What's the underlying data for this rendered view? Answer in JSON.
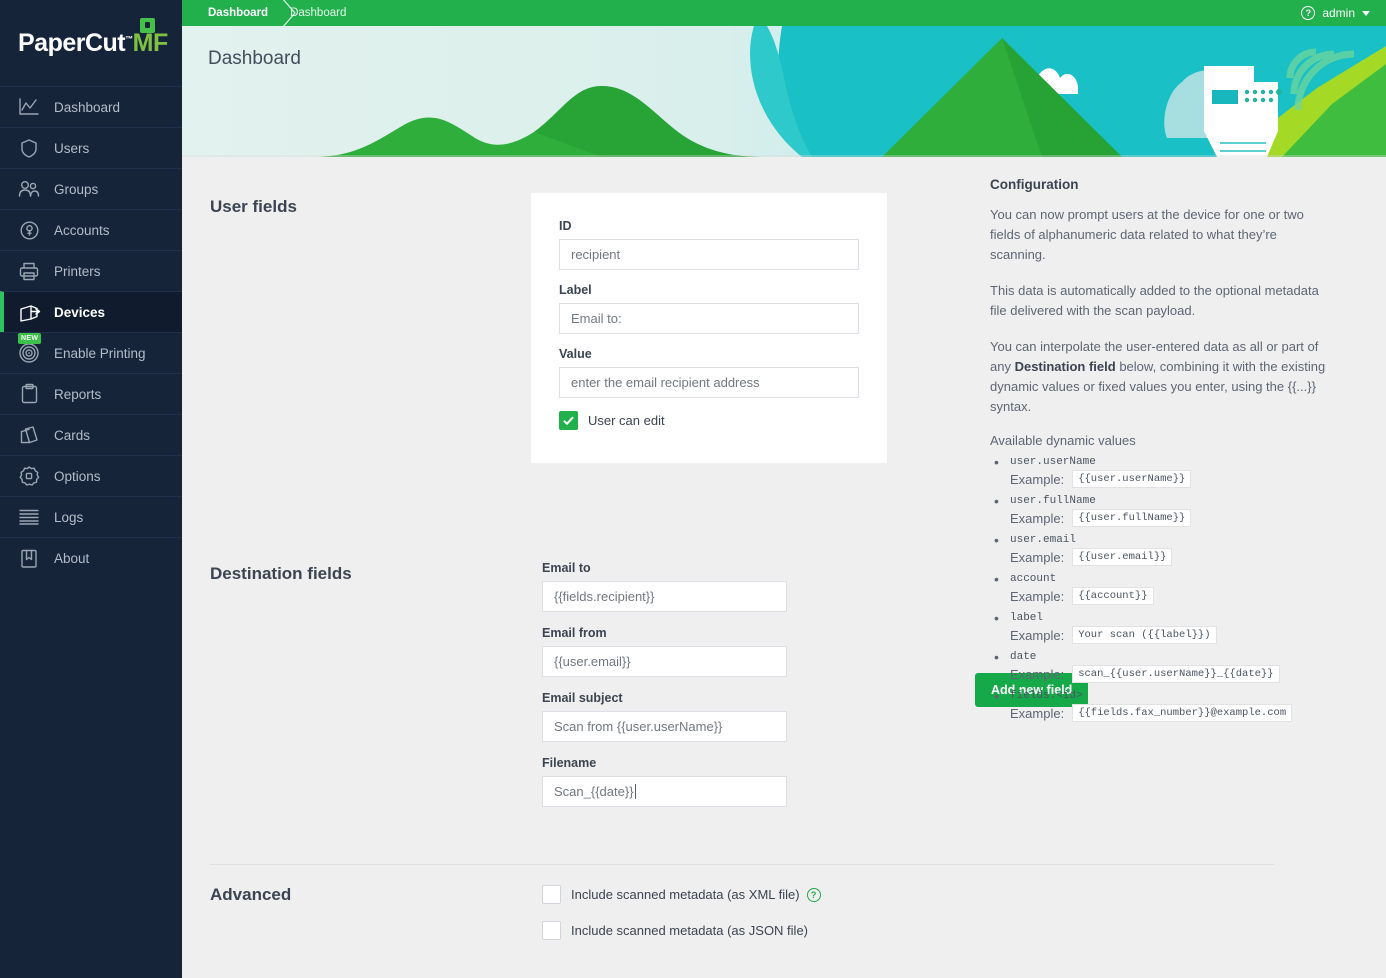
{
  "sidebar": {
    "logo": {
      "part1": "PaperCut",
      "part2": "MF",
      "tm": "™"
    },
    "items": [
      {
        "label": "Dashboard",
        "icon": "chart-line-icon",
        "active": false
      },
      {
        "label": "Users",
        "icon": "shield-icon",
        "active": false
      },
      {
        "label": "Groups",
        "icon": "people-icon",
        "active": false
      },
      {
        "label": "Accounts",
        "icon": "account-circle-icon",
        "active": false
      },
      {
        "label": "Printers",
        "icon": "printer-icon",
        "active": false
      },
      {
        "label": "Devices",
        "icon": "device-icon",
        "active": true
      },
      {
        "label": "Enable Printing",
        "icon": "target-icon",
        "active": false,
        "badge": "NEW"
      },
      {
        "label": "Reports",
        "icon": "clipboard-icon",
        "active": false
      },
      {
        "label": "Cards",
        "icon": "cards-icon",
        "active": false
      },
      {
        "label": "Options",
        "icon": "gear-icon",
        "active": false
      },
      {
        "label": "Logs",
        "icon": "lines-icon",
        "active": false
      },
      {
        "label": "About",
        "icon": "book-icon",
        "active": false
      }
    ]
  },
  "topbar": {
    "breadcrumb": [
      "Dashboard",
      "Dashboard"
    ],
    "help_glyph": "?",
    "user": "admin"
  },
  "hero": {
    "title": "Dashboard"
  },
  "user_fields": {
    "section_title": "User fields",
    "template_chip": "{{fields.recipient}}",
    "fields": [
      {
        "label": "ID",
        "value": "recipient"
      },
      {
        "label": "Label",
        "value": "Email to:"
      },
      {
        "label": "Value",
        "value": "enter the email recipient address"
      }
    ],
    "user_can_edit": {
      "label": "User can edit",
      "checked": true,
      "check_glyph": "✓"
    },
    "add_button": "Add new field"
  },
  "destination_fields": {
    "section_title": "Destination fields",
    "fields": [
      {
        "label": "Email to",
        "value": "{{fields.recipient}}",
        "caret": false
      },
      {
        "label": "Email from",
        "value": "{{user.email}}",
        "caret": false
      },
      {
        "label": "Email subject",
        "value": "Scan from {{user.userName}}",
        "caret": false
      },
      {
        "label": "Filename",
        "value": "Scan_{{date}}",
        "caret": true
      }
    ]
  },
  "advanced": {
    "section_title": "Advanced",
    "options": [
      {
        "label": "Include scanned metadata (as XML file)",
        "checked": false,
        "help": true,
        "help_glyph": "?"
      },
      {
        "label": "Include scanned metadata (as JSON file)",
        "checked": false,
        "help": false
      }
    ]
  },
  "configuration": {
    "heading": "Configuration",
    "paragraph1": "You can now prompt users at the device for one or two fields of alphanumeric data related to what they’re scanning.",
    "paragraph2": "This data is automatically added to the optional metadata file delivered with the scan payload.",
    "paragraph3_a": "You can interpolate the user-entered data as all or part of any ",
    "paragraph3_b": "Destination field",
    "paragraph3_c": " below, combining it with the existing dynamic values or fixed values you enter, using the {{...}} syntax.",
    "available_heading": "Available dynamic values",
    "example_label": "Example:",
    "dynamic_values": [
      {
        "key": "user.userName",
        "example": "{{user.userName}}"
      },
      {
        "key": "user.fullName",
        "example": "{{user.fullName}}"
      },
      {
        "key": "user.email",
        "example": "{{user.email}}"
      },
      {
        "key": "account",
        "example": "{{account}}"
      },
      {
        "key": "label",
        "example": "Your scan ({{label}})"
      },
      {
        "key": "date",
        "example": "scan_{{user.userName}}_{{date}}"
      },
      {
        "key": "fields.<id>",
        "example": "{{fields.fax_number}}@example.com"
      }
    ]
  },
  "colors": {
    "brand_green": "#22b04d",
    "sidebar_bg": "#16243a",
    "accent_green": "#2ec45f",
    "page_bg": "#efefef"
  }
}
